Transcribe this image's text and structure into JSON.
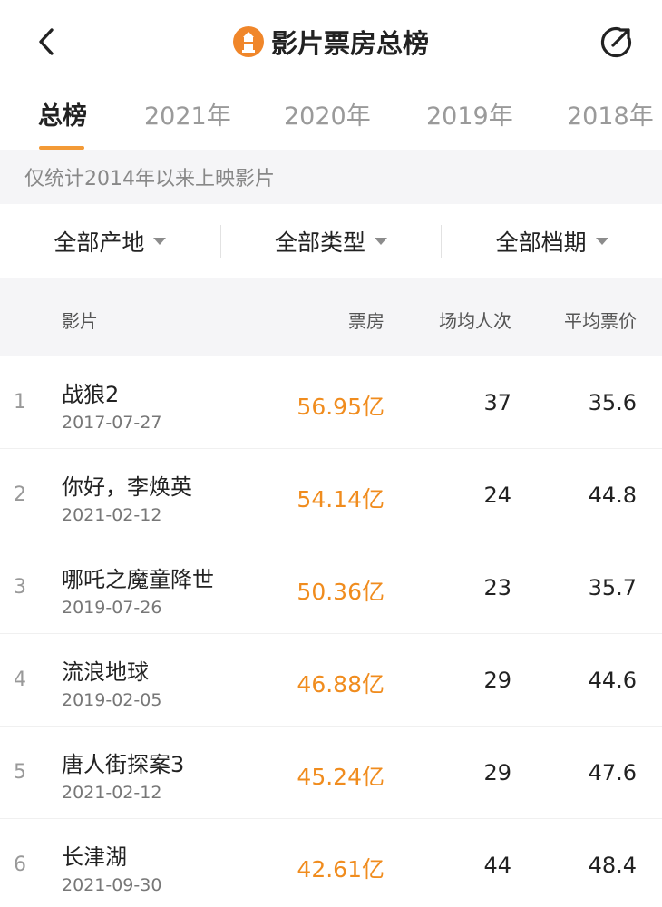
{
  "header": {
    "title": "影片票房总榜"
  },
  "tabs": [
    {
      "label": "总榜"
    },
    {
      "label": "2021年"
    },
    {
      "label": "2020年"
    },
    {
      "label": "2019年"
    },
    {
      "label": "2018年"
    }
  ],
  "notice": "仅统计2014年以来上映影片",
  "filters": [
    {
      "label": "全部产地"
    },
    {
      "label": "全部类型"
    },
    {
      "label": "全部档期"
    }
  ],
  "table": {
    "headers": {
      "film": "影片",
      "box_office": "票房",
      "avg_people": "场均人次",
      "avg_price": "平均票价"
    },
    "rows": [
      {
        "rank": "1",
        "name": "战狼2",
        "date": "2017-07-27",
        "box": "56.95亿",
        "avg_people": "37",
        "avg_price": "35.6"
      },
      {
        "rank": "2",
        "name": "你好，李焕英",
        "date": "2021-02-12",
        "box": "54.14亿",
        "avg_people": "24",
        "avg_price": "44.8"
      },
      {
        "rank": "3",
        "name": "哪吒之魔童降世",
        "date": "2019-07-26",
        "box": "50.36亿",
        "avg_people": "23",
        "avg_price": "35.7"
      },
      {
        "rank": "4",
        "name": "流浪地球",
        "date": "2019-02-05",
        "box": "46.88亿",
        "avg_people": "29",
        "avg_price": "44.6"
      },
      {
        "rank": "5",
        "name": "唐人街探案3",
        "date": "2021-02-12",
        "box": "45.24亿",
        "avg_people": "29",
        "avg_price": "47.6"
      },
      {
        "rank": "6",
        "name": "长津湖",
        "date": "2021-09-30",
        "box": "42.61亿",
        "avg_people": "44",
        "avg_price": "48.4"
      }
    ]
  },
  "colors": {
    "accent": "#f39a36",
    "box_office": "#f08c1e",
    "header_bg": "#f5f5f7"
  },
  "icons": {
    "back": "chevron-left-icon",
    "logo": "lighthouse-logo-icon",
    "share": "share-arrow-icon"
  }
}
